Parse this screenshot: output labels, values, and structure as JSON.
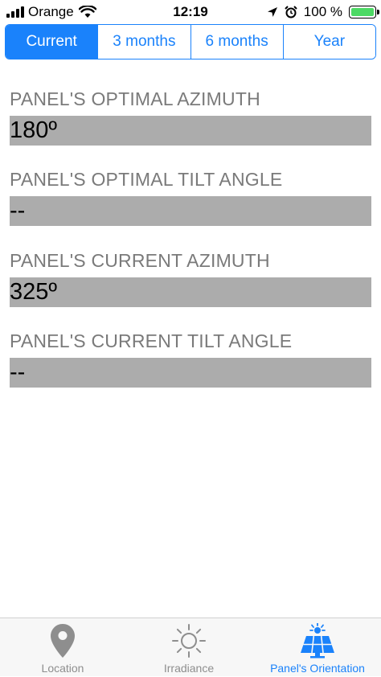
{
  "status_bar": {
    "carrier": "Orange",
    "time": "12:19",
    "battery_percent": "100 %",
    "battery_level": 1.0
  },
  "segments": {
    "items": [
      {
        "label": "Current",
        "active": true
      },
      {
        "label": "3 months",
        "active": false
      },
      {
        "label": "6 months",
        "active": false
      },
      {
        "label": "Year",
        "active": false
      }
    ]
  },
  "fields": [
    {
      "label": "PANEL'S OPTIMAL AZIMUTH",
      "value": "180º"
    },
    {
      "label": "PANEL'S OPTIMAL TILT ANGLE",
      "value": "--"
    },
    {
      "label": "PANEL'S CURRENT AZIMUTH",
      "value": "325º"
    },
    {
      "label": "PANEL'S CURRENT TILT ANGLE",
      "value": "--"
    }
  ],
  "tab_bar": {
    "items": [
      {
        "label": "Location",
        "icon": "map-pin-icon",
        "active": false
      },
      {
        "label": "Irradiance",
        "icon": "sun-icon",
        "active": false
      },
      {
        "label": "Panel's Orientation",
        "icon": "solar-panel-icon",
        "active": true
      }
    ]
  },
  "colors": {
    "accent": "#1a82fb",
    "value_background": "#acacac",
    "label_text": "#7a7a7a",
    "inactive_tab": "#8e8e8e",
    "battery": "#4cd964"
  }
}
